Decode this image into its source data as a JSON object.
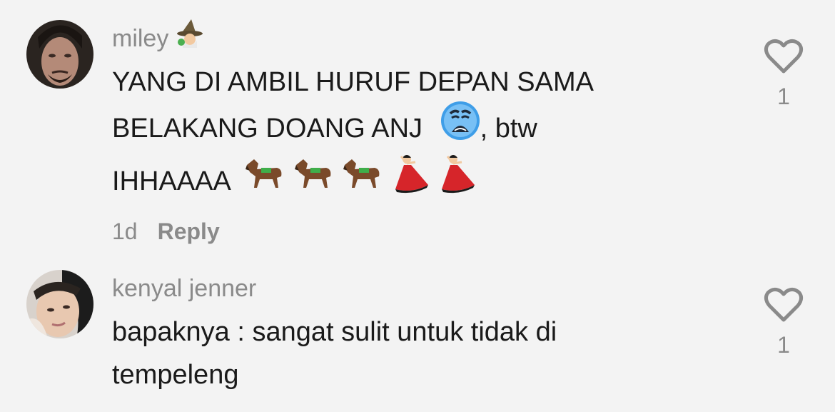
{
  "comments": [
    {
      "username": "miley",
      "line1": "YANG DI AMBIL HURUF DEPAN SAMA",
      "line2a": "BELAKANG DOANG ANJ",
      "line2b": ", btw",
      "line3": "IHHAAAA",
      "time": "1d",
      "reply_label": "Reply",
      "likes": "1",
      "badge_icon": "wizard-emoji",
      "inline_emojis": [
        "crying-face",
        "horse",
        "horse",
        "horse",
        "dancer",
        "dancer"
      ]
    },
    {
      "username": "kenyal jenner",
      "line1": "bapaknya : sangat sulit untuk tidak di",
      "line2": "tempeleng",
      "likes": "1"
    }
  ],
  "colors": {
    "background": "#f3f3f3",
    "text": "#1a1a1a",
    "muted": "#8a8a8a"
  }
}
